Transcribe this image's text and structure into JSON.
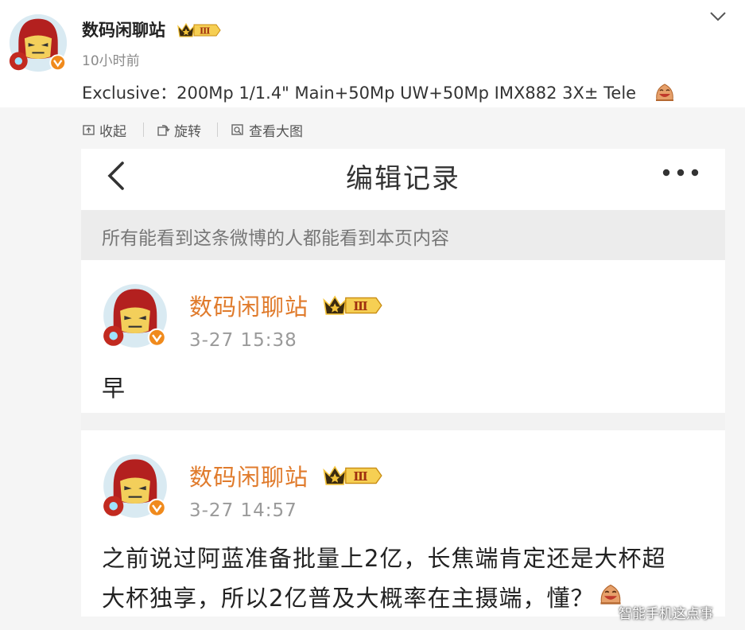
{
  "post": {
    "author": "数码闲聊站",
    "time": "10小时前",
    "text": "Exclusive：200Mp 1/1.4\" Main+50Mp UW+50Mp IMX882 3X± Tele",
    "vip_level": "III",
    "avatar_icon": "iron-man-avatar",
    "verified_icon": "verified-v-badge"
  },
  "toolbar": {
    "collapse_label": "收起",
    "rotate_label": "旋转",
    "view_large_label": "查看大图"
  },
  "edit_history": {
    "title": "编辑记录",
    "notice": "所有能看到这条微博的人都能看到本页内容",
    "entries": [
      {
        "author": "数码闲聊站",
        "vip_level": "III",
        "time": "3-27 15:38",
        "text_lines": [
          "早"
        ]
      },
      {
        "author": "数码闲聊站",
        "vip_level": "III",
        "time": "3-27 14:57",
        "text_lines": [
          "之前说过阿蓝准备批量上2亿，长焦端肯定还是大杯超",
          "大杯独享，所以2亿普及大概率在主摄端，懂？"
        ]
      }
    ]
  },
  "watermark": "智能手机这点事",
  "colors": {
    "name_orange": "#e07b2c",
    "badge_gold": "#f3c33a",
    "verified_orange": "#f08a1c",
    "page_gray": "#f5f5f5"
  }
}
